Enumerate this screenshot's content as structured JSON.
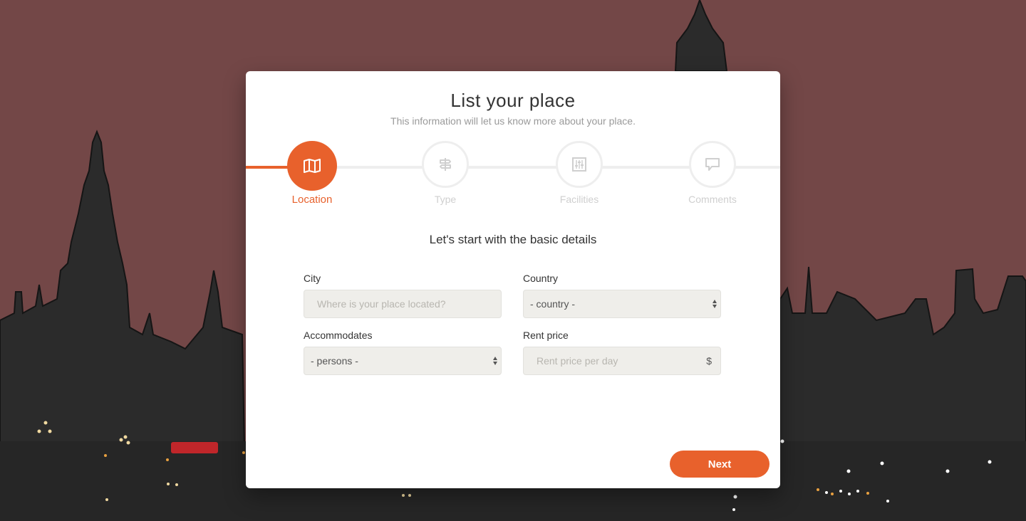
{
  "colors": {
    "accent": "#e8612c",
    "sky": "#734747",
    "city": "#2b2b2b"
  },
  "wizard": {
    "title": "List your place",
    "subtitle": "This information will let us know more about your place.",
    "steps": [
      {
        "label": "Location",
        "icon": "map-icon",
        "active": true
      },
      {
        "label": "Type",
        "icon": "signpost-icon",
        "active": false
      },
      {
        "label": "Facilities",
        "icon": "sliders-icon",
        "active": false
      },
      {
        "label": "Comments",
        "icon": "comment-icon",
        "active": false
      }
    ],
    "section_title": "Let's start with the basic details"
  },
  "form": {
    "city": {
      "label": "City",
      "placeholder": "Where is your place located?",
      "value": ""
    },
    "country": {
      "label": "Country",
      "value": "- country -"
    },
    "accommodates": {
      "label": "Accommodates",
      "value": "- persons -"
    },
    "rent_price": {
      "label": "Rent price",
      "placeholder": "Rent price per day",
      "value": "",
      "currency": "$"
    }
  },
  "actions": {
    "next_label": "Next"
  }
}
